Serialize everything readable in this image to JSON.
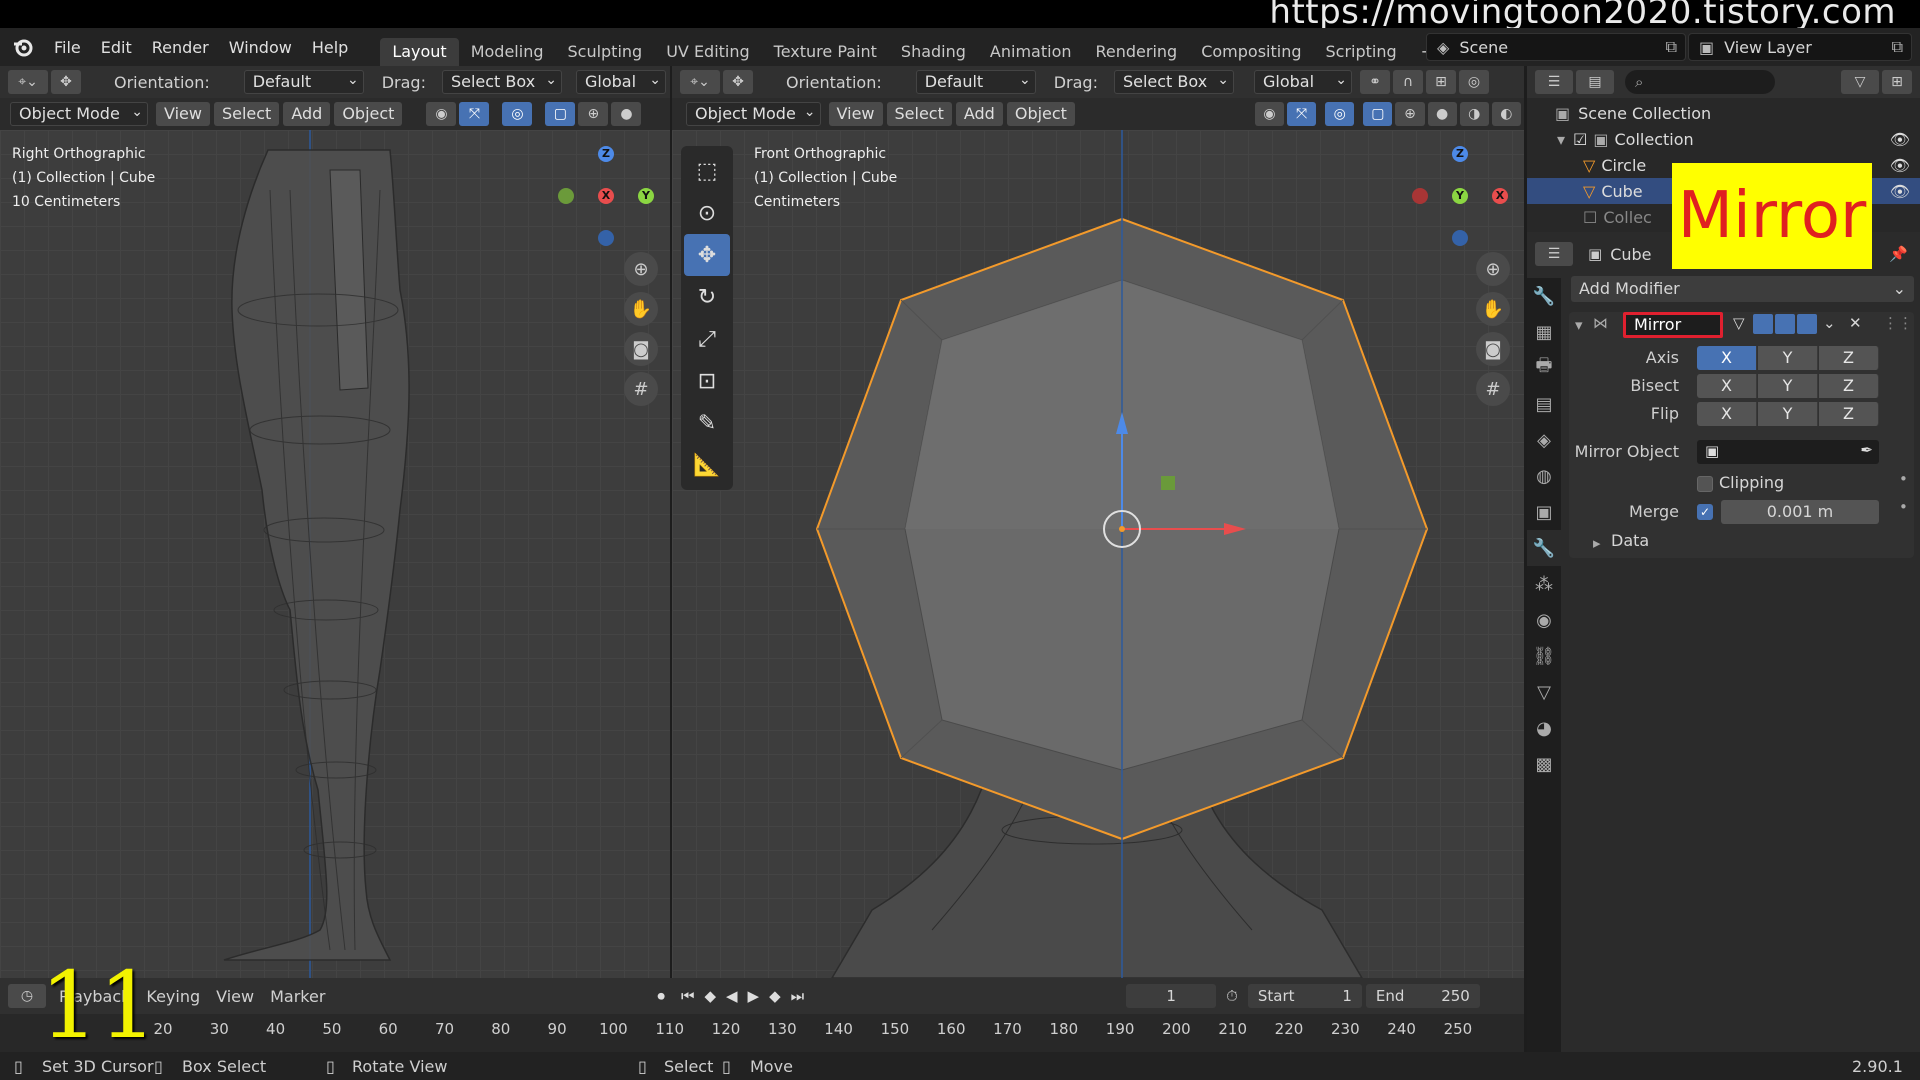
{
  "watermark": "https://movingtoon2020.tistory.com",
  "menu": [
    "File",
    "Edit",
    "Render",
    "Window",
    "Help"
  ],
  "workspaces": [
    "Layout",
    "Modeling",
    "Sculpting",
    "UV Editing",
    "Texture Paint",
    "Shading",
    "Animation",
    "Rendering",
    "Compositing",
    "Scripting"
  ],
  "active_workspace": "Layout",
  "scene": "Scene",
  "view_layer": "View Layer",
  "left_view": {
    "orientation_label": "Orientation:",
    "orientation_value": "Default",
    "drag_label": "Drag:",
    "drag_value": "Select Box",
    "transform_space": "Global",
    "mode": "Object Mode",
    "menus": [
      "View",
      "Select",
      "Add",
      "Object"
    ],
    "info_line1": "Right Orthographic",
    "info_line2": "(1) Collection | Cube",
    "info_line3": "10 Centimeters"
  },
  "right_view": {
    "orientation_label": "Orientation:",
    "orientation_value": "Default",
    "drag_label": "Drag:",
    "drag_value": "Select Box",
    "transform_space": "Global",
    "mode": "Object Mode",
    "menus": [
      "View",
      "Select",
      "Add",
      "Object"
    ],
    "info_line1": "Front Orthographic",
    "info_line2": "(1) Collection | Cube",
    "info_line3": "Centimeters"
  },
  "outliner": {
    "scene_collection": "Scene Collection",
    "collection": "Collection",
    "items": [
      "Circle",
      "Cube",
      "Collec"
    ]
  },
  "properties": {
    "object_name": "Cube",
    "add_modifier": "Add Modifier",
    "modifier_name": "Mirror",
    "axis_label": "Axis",
    "bisect_label": "Bisect",
    "flip_label": "Flip",
    "axes": [
      "X",
      "Y",
      "Z"
    ],
    "mirror_object_label": "Mirror Object",
    "clipping_label": "Clipping",
    "merge_label": "Merge",
    "merge_value": "0.001 m",
    "data_label": "Data"
  },
  "callout": "Mirror",
  "timeline": {
    "playback": "Playback",
    "keying": "Keying",
    "view": "View",
    "marker": "Marker",
    "current_frame": "1",
    "start_label": "Start",
    "start_value": "1",
    "end_label": "End",
    "end_value": "250",
    "ticks": [
      "20",
      "30",
      "40",
      "50",
      "60",
      "70",
      "80",
      "90",
      "100",
      "110",
      "120",
      "130",
      "140",
      "150",
      "160",
      "170",
      "180",
      "190",
      "200",
      "210",
      "220",
      "230",
      "240",
      "250"
    ]
  },
  "step_number": "11",
  "status": {
    "set_cursor": "Set 3D Cursor",
    "box_select": "Box Select",
    "rotate_view": "Rotate View",
    "select": "Select",
    "move": "Move",
    "version": "2.90.1"
  },
  "colors": {
    "accent_blue": "#4772b3",
    "selection_orange": "#f39a2b",
    "callout_yellow": "#ffff00",
    "callout_red": "#e02020",
    "highlight_box": "#e0202f"
  }
}
